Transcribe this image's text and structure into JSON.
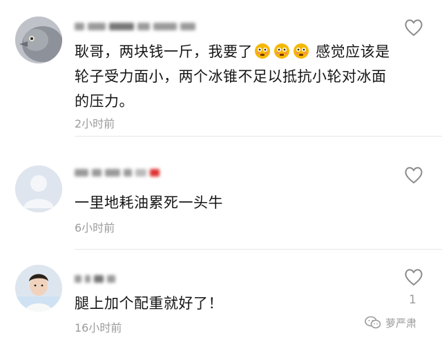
{
  "comments": [
    {
      "text_part1": "耿哥，两块钱一斤，我要了",
      "text_part2": " 感觉应该是轮子受力面小，两个冰锥不足以抵抗小轮对冰面的压力。",
      "emojis": [
        "flushed-face-emoji",
        "flushed-face-emoji",
        "flushed-face-emoji"
      ],
      "time": "2小时前",
      "likes": ""
    },
    {
      "text": "一里地耗油累死一头牛",
      "time": "6小时前",
      "likes": ""
    },
    {
      "text": "腿上加个配重就好了！",
      "time": "16小时前",
      "likes": "1"
    }
  ],
  "watermark": {
    "text": "萝严肃",
    "icon": "wechat-icon"
  },
  "colors": {
    "text": "#151515",
    "meta": "#9b9b9b",
    "divider": "#e6e6e6",
    "emoji": "#f5b800"
  }
}
